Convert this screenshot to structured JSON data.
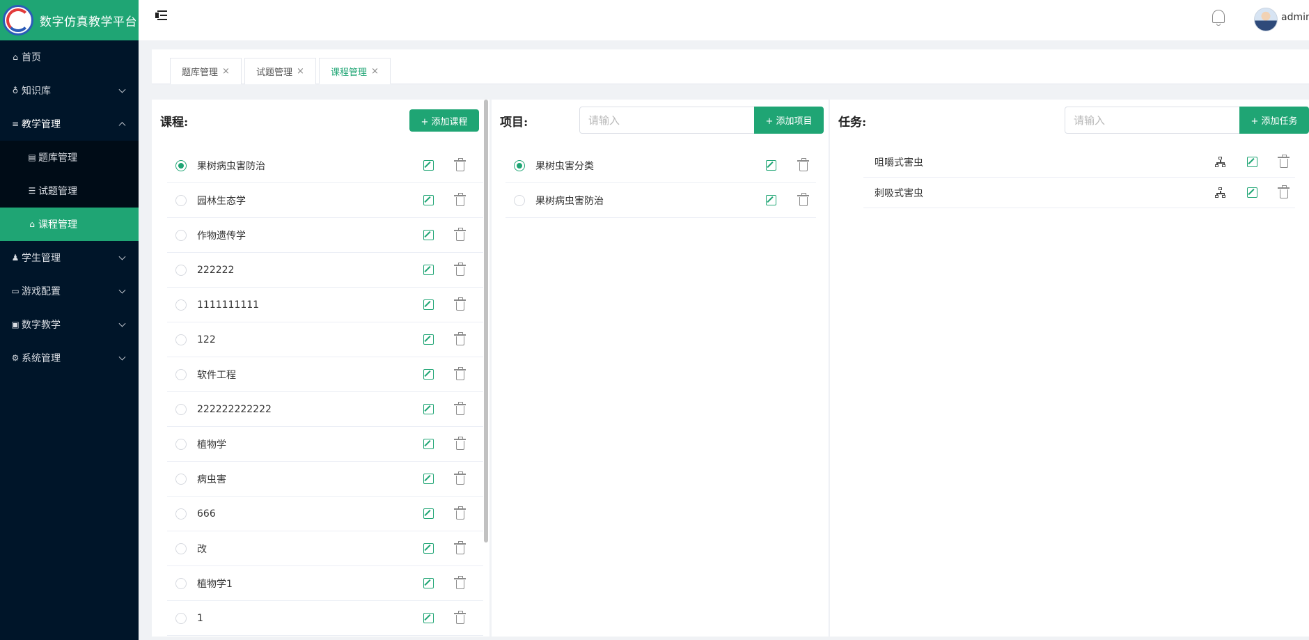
{
  "app": {
    "title": "数字仿真教学平台"
  },
  "sidebar": {
    "items": [
      {
        "label": "首页",
        "icon": "home-icon"
      },
      {
        "label": "知识库",
        "icon": "knowledge-icon"
      },
      {
        "label": "教学管理",
        "icon": "menu-list-icon"
      },
      {
        "label": "学生管理",
        "icon": "student-icon"
      },
      {
        "label": "游戏配置",
        "icon": "game-icon"
      },
      {
        "label": "数字教学",
        "icon": "digital-icon"
      },
      {
        "label": "系统管理",
        "icon": "settings-icon"
      }
    ],
    "submenu": [
      {
        "label": "题库管理",
        "icon": "question-bank-icon"
      },
      {
        "label": "试题管理",
        "icon": "exam-icon"
      },
      {
        "label": "课程管理",
        "icon": "home-icon"
      }
    ]
  },
  "header": {
    "username": "admin"
  },
  "tabs": [
    {
      "label": "题库管理",
      "close": "×"
    },
    {
      "label": "试题管理",
      "close": "×"
    },
    {
      "label": "课程管理",
      "close": "×"
    }
  ],
  "course": {
    "title": "课程:",
    "add_button": "+ 添加课程",
    "selected_index": 0,
    "items": [
      "果树病虫害防治",
      "园林生态学",
      "作物遗传学",
      "222222",
      "1111111111",
      "122",
      "软件工程",
      "222222222222",
      "植物学",
      "病虫害",
      "666",
      "改",
      "植物学1",
      "1"
    ]
  },
  "project": {
    "title": "项目:",
    "search_placeholder": "请输入",
    "add_button": "+ 添加项目",
    "selected_index": 0,
    "items": [
      "果树虫害分类",
      "果树病虫害防治"
    ]
  },
  "task": {
    "title": "任务:",
    "search_placeholder": "请输入",
    "add_button": "+ 添加任务",
    "items": [
      "咀嚼式害虫",
      "刺吸式害虫"
    ]
  },
  "colors": {
    "primary": "#1fa574",
    "sidebar_bg": "#001529",
    "submenu_bg": "#000c17"
  }
}
